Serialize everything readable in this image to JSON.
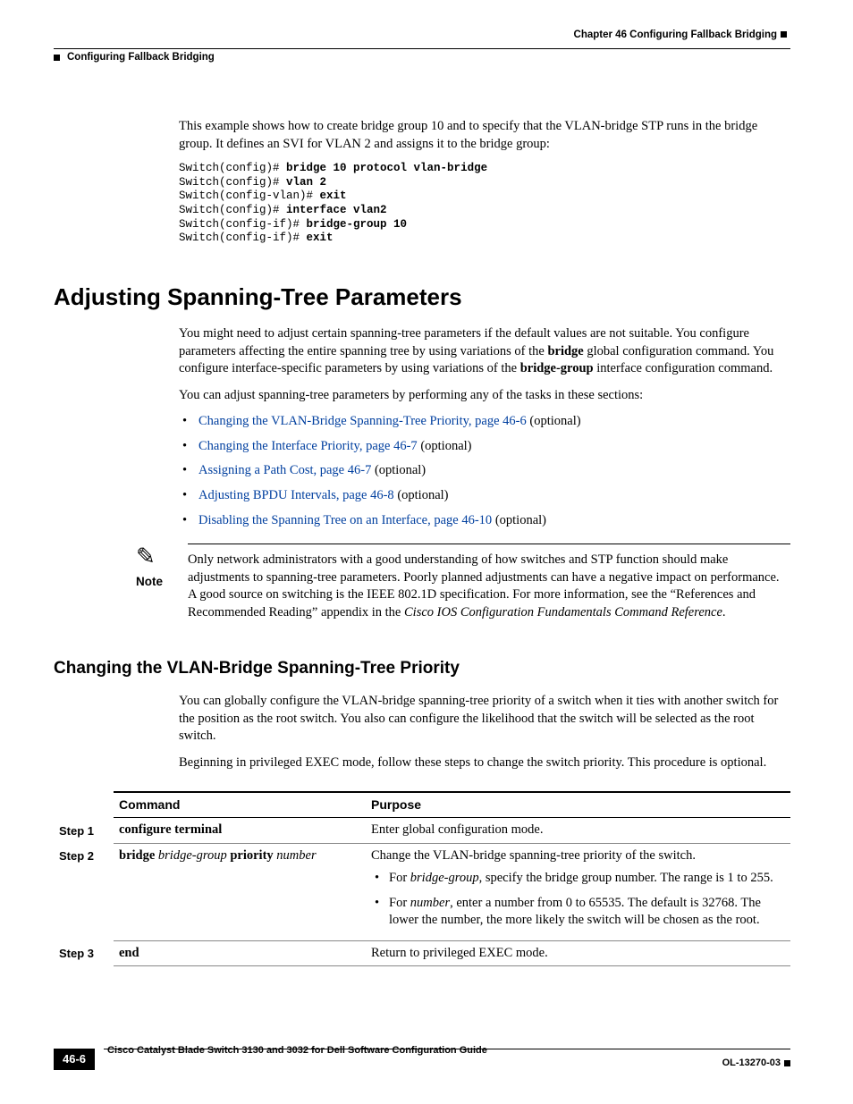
{
  "header": {
    "chapter_line": "Chapter 46      Configuring Fallback Bridging",
    "section_line": "Configuring Fallback Bridging"
  },
  "intro_para": "This example shows how to create bridge group 10 and to specify that the VLAN-bridge STP runs in the bridge group. It defines an SVI for VLAN 2 and assigns it to the bridge group:",
  "code": {
    "l1p": "Switch(config)# ",
    "l1c": "bridge 10 protocol vlan-bridge",
    "l2p": "Switch(config)# ",
    "l2c": "vlan 2",
    "l3p": "Switch(config-vlan)# ",
    "l3c": "exit",
    "l4p": "Switch(config)# ",
    "l4c": "interface vlan2",
    "l5p": "Switch(config-if)# ",
    "l5c": "bridge-group 10",
    "l6p": "Switch(config-if)# ",
    "l6c": "exit"
  },
  "h1": "Adjusting Spanning-Tree Parameters",
  "para1a": "You might need to adjust certain spanning-tree parameters if the default values are not suitable. You configure parameters affecting the entire spanning tree by using variations of the ",
  "para1b": "bridge",
  "para1c": " global configuration command. You configure interface-specific parameters by using variations of the ",
  "para1d": "bridge-group",
  "para1e": " interface configuration command.",
  "para2": "You can adjust spanning-tree parameters by performing any of the tasks in these sections:",
  "bullets": [
    {
      "link": "Changing the VLAN-Bridge Spanning-Tree Priority, page 46-6",
      "suffix": " (optional)"
    },
    {
      "link": "Changing the Interface Priority, page 46-7",
      "suffix": " (optional)"
    },
    {
      "link": "Assigning a Path Cost, page 46-7",
      "suffix": " (optional)"
    },
    {
      "link": "Adjusting BPDU Intervals, page 46-8",
      "suffix": " (optional)"
    },
    {
      "link": "Disabling the Spanning Tree on an Interface, page 46-10",
      "suffix": " (optional)"
    }
  ],
  "note": {
    "label": "Note",
    "body_a": "Only network administrators with a good understanding of how switches and STP function should make adjustments to spanning-tree parameters. Poorly planned adjustments can have a negative impact on performance. A good source on switching is the IEEE 802.1D specification. For more information, see the “References and Recommended Reading” appendix in the ",
    "body_i": "Cisco IOS Configuration Fundamentals Command Reference",
    "body_b": "."
  },
  "h2": "Changing the VLAN-Bridge Spanning-Tree Priority",
  "h2_para1": "You can globally configure the VLAN-bridge spanning-tree priority of a switch when it ties with another switch for the position as the root switch. You also can configure the likelihood that the switch will be selected as the root switch.",
  "h2_para2": "Beginning in privileged EXEC mode, follow these steps to change the switch priority. This procedure is optional.",
  "table": {
    "headers": {
      "cmd": "Command",
      "purpose": "Purpose"
    },
    "rows": [
      {
        "step": "Step 1",
        "cmd_bold": "configure terminal",
        "purpose": "Enter global configuration mode."
      },
      {
        "step": "Step 2",
        "cmd_b1": "bridge ",
        "cmd_i1": "bridge-group ",
        "cmd_b2": "priority ",
        "cmd_i2": "number",
        "purpose_intro": "Change the VLAN-bridge spanning-tree priority of the switch.",
        "li1a": "For ",
        "li1i": "bridge-group",
        "li1b": ", specify the bridge group number. The range is 1 to 255.",
        "li2a": "For ",
        "li2i": "number",
        "li2b": ", enter a number from 0 to 65535. The default is 32768. The lower the number, the more likely the switch will be chosen as the root."
      },
      {
        "step": "Step 3",
        "cmd_bold": "end",
        "purpose": "Return to privileged EXEC mode."
      }
    ]
  },
  "footer": {
    "page": "46-6",
    "title": "Cisco Catalyst Blade Switch 3130 and 3032 for Dell Software Configuration Guide",
    "code": "OL-13270-03"
  }
}
